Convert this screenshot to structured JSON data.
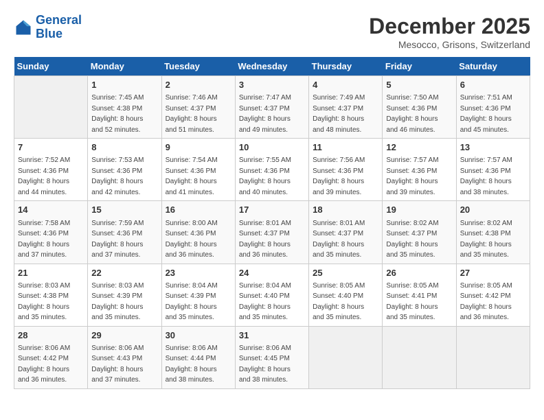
{
  "header": {
    "logo_line1": "General",
    "logo_line2": "Blue",
    "month": "December 2025",
    "location": "Mesocco, Grisons, Switzerland"
  },
  "days_of_week": [
    "Sunday",
    "Monday",
    "Tuesday",
    "Wednesday",
    "Thursday",
    "Friday",
    "Saturday"
  ],
  "weeks": [
    [
      {
        "day": "",
        "info": ""
      },
      {
        "day": "1",
        "info": "Sunrise: 7:45 AM\nSunset: 4:38 PM\nDaylight: 8 hours\nand 52 minutes."
      },
      {
        "day": "2",
        "info": "Sunrise: 7:46 AM\nSunset: 4:37 PM\nDaylight: 8 hours\nand 51 minutes."
      },
      {
        "day": "3",
        "info": "Sunrise: 7:47 AM\nSunset: 4:37 PM\nDaylight: 8 hours\nand 49 minutes."
      },
      {
        "day": "4",
        "info": "Sunrise: 7:49 AM\nSunset: 4:37 PM\nDaylight: 8 hours\nand 48 minutes."
      },
      {
        "day": "5",
        "info": "Sunrise: 7:50 AM\nSunset: 4:36 PM\nDaylight: 8 hours\nand 46 minutes."
      },
      {
        "day": "6",
        "info": "Sunrise: 7:51 AM\nSunset: 4:36 PM\nDaylight: 8 hours\nand 45 minutes."
      }
    ],
    [
      {
        "day": "7",
        "info": "Sunrise: 7:52 AM\nSunset: 4:36 PM\nDaylight: 8 hours\nand 44 minutes."
      },
      {
        "day": "8",
        "info": "Sunrise: 7:53 AM\nSunset: 4:36 PM\nDaylight: 8 hours\nand 42 minutes."
      },
      {
        "day": "9",
        "info": "Sunrise: 7:54 AM\nSunset: 4:36 PM\nDaylight: 8 hours\nand 41 minutes."
      },
      {
        "day": "10",
        "info": "Sunrise: 7:55 AM\nSunset: 4:36 PM\nDaylight: 8 hours\nand 40 minutes."
      },
      {
        "day": "11",
        "info": "Sunrise: 7:56 AM\nSunset: 4:36 PM\nDaylight: 8 hours\nand 39 minutes."
      },
      {
        "day": "12",
        "info": "Sunrise: 7:57 AM\nSunset: 4:36 PM\nDaylight: 8 hours\nand 39 minutes."
      },
      {
        "day": "13",
        "info": "Sunrise: 7:57 AM\nSunset: 4:36 PM\nDaylight: 8 hours\nand 38 minutes."
      }
    ],
    [
      {
        "day": "14",
        "info": "Sunrise: 7:58 AM\nSunset: 4:36 PM\nDaylight: 8 hours\nand 37 minutes."
      },
      {
        "day": "15",
        "info": "Sunrise: 7:59 AM\nSunset: 4:36 PM\nDaylight: 8 hours\nand 37 minutes."
      },
      {
        "day": "16",
        "info": "Sunrise: 8:00 AM\nSunset: 4:36 PM\nDaylight: 8 hours\nand 36 minutes."
      },
      {
        "day": "17",
        "info": "Sunrise: 8:01 AM\nSunset: 4:37 PM\nDaylight: 8 hours\nand 36 minutes."
      },
      {
        "day": "18",
        "info": "Sunrise: 8:01 AM\nSunset: 4:37 PM\nDaylight: 8 hours\nand 35 minutes."
      },
      {
        "day": "19",
        "info": "Sunrise: 8:02 AM\nSunset: 4:37 PM\nDaylight: 8 hours\nand 35 minutes."
      },
      {
        "day": "20",
        "info": "Sunrise: 8:02 AM\nSunset: 4:38 PM\nDaylight: 8 hours\nand 35 minutes."
      }
    ],
    [
      {
        "day": "21",
        "info": "Sunrise: 8:03 AM\nSunset: 4:38 PM\nDaylight: 8 hours\nand 35 minutes."
      },
      {
        "day": "22",
        "info": "Sunrise: 8:03 AM\nSunset: 4:39 PM\nDaylight: 8 hours\nand 35 minutes."
      },
      {
        "day": "23",
        "info": "Sunrise: 8:04 AM\nSunset: 4:39 PM\nDaylight: 8 hours\nand 35 minutes."
      },
      {
        "day": "24",
        "info": "Sunrise: 8:04 AM\nSunset: 4:40 PM\nDaylight: 8 hours\nand 35 minutes."
      },
      {
        "day": "25",
        "info": "Sunrise: 8:05 AM\nSunset: 4:40 PM\nDaylight: 8 hours\nand 35 minutes."
      },
      {
        "day": "26",
        "info": "Sunrise: 8:05 AM\nSunset: 4:41 PM\nDaylight: 8 hours\nand 35 minutes."
      },
      {
        "day": "27",
        "info": "Sunrise: 8:05 AM\nSunset: 4:42 PM\nDaylight: 8 hours\nand 36 minutes."
      }
    ],
    [
      {
        "day": "28",
        "info": "Sunrise: 8:06 AM\nSunset: 4:42 PM\nDaylight: 8 hours\nand 36 minutes."
      },
      {
        "day": "29",
        "info": "Sunrise: 8:06 AM\nSunset: 4:43 PM\nDaylight: 8 hours\nand 37 minutes."
      },
      {
        "day": "30",
        "info": "Sunrise: 8:06 AM\nSunset: 4:44 PM\nDaylight: 8 hours\nand 38 minutes."
      },
      {
        "day": "31",
        "info": "Sunrise: 8:06 AM\nSunset: 4:45 PM\nDaylight: 8 hours\nand 38 minutes."
      },
      {
        "day": "",
        "info": ""
      },
      {
        "day": "",
        "info": ""
      },
      {
        "day": "",
        "info": ""
      }
    ]
  ]
}
